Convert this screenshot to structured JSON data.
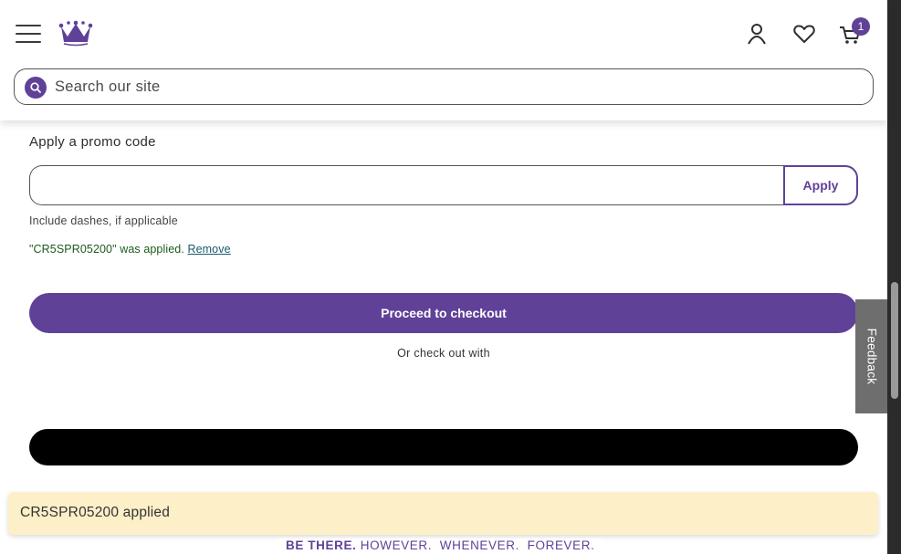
{
  "header": {
    "menu_icon": "hamburger-menu-icon",
    "logo_icon": "crown-logo-icon",
    "account_icon": "account-icon",
    "wishlist_icon": "heart-icon",
    "cart_icon": "cart-icon",
    "cart_count": "1"
  },
  "search": {
    "placeholder": "Search our site",
    "icon": "search-icon"
  },
  "promo": {
    "label": "Apply a promo code",
    "input_value": "",
    "apply_label": "Apply",
    "hint": "Include dashes, if applicable",
    "applied_message": "\"CR5SPR05200\" was applied.",
    "remove_label": "Remove"
  },
  "checkout": {
    "proceed_label": "Proceed to checkout",
    "or_text": "Or check out with"
  },
  "toast": {
    "message": "CR5SPR05200 applied"
  },
  "tagline": {
    "bold": "BE THERE.",
    "rest": "HOWEVER.  WHENEVER.  FOREVER."
  },
  "feedback": {
    "label": "Feedback"
  },
  "colors": {
    "brand_purple": "#604198",
    "toast_bg": "#fdefc8",
    "success_green": "#1c5c1c",
    "feedback_gray": "#6e6e6e"
  }
}
